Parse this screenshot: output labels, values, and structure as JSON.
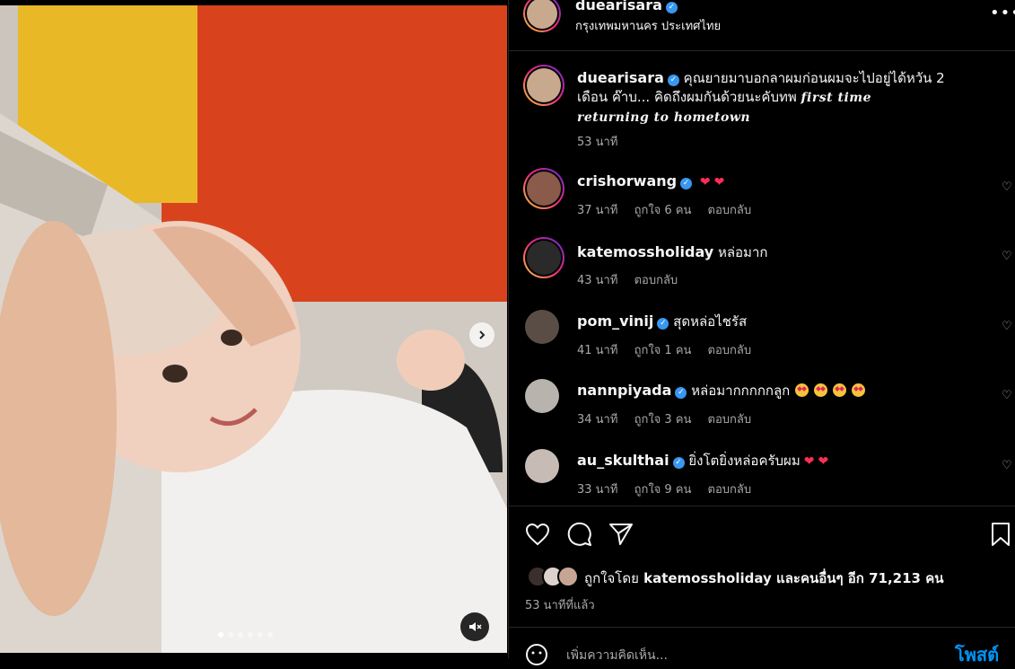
{
  "post": {
    "username": "duearisara",
    "location": "กรุงเทพมหานคร ประเทศไทย",
    "caption_text": "คุณยายมาบอกลาผมก่อนผมจะไปอยู่ได้หวัน 2 เดือน ค๊าบ... คิดถึงผมกันด้วยนะคับทพ",
    "caption_styled": "first time returning to hometown",
    "caption_time": "53 นาที"
  },
  "comments": [
    {
      "username": "crishorwang",
      "verified": true,
      "text": "",
      "reaction": "hearts",
      "time": "37 นาที",
      "likes": "ถูกใจ 6 คน",
      "reply": "ตอบกลับ"
    },
    {
      "username": "katemossholiday",
      "verified": false,
      "text": "หล่อมาก",
      "time": "43 นาที",
      "likes": "",
      "reply": "ตอบกลับ"
    },
    {
      "username": "pom_vinij",
      "verified": true,
      "text": "สุดหล่อไชรัส",
      "time": "41 นาที",
      "likes": "ถูกใจ 1 คน",
      "reply": "ตอบกลับ"
    },
    {
      "username": "nannpiyada",
      "verified": true,
      "text": "หล่อมากกกกกลูก",
      "reaction": "star-eyes",
      "time": "34 นาที",
      "likes": "ถูกใจ 3 คน",
      "reply": "ตอบกลับ"
    },
    {
      "username": "au_skulthai",
      "verified": true,
      "text": "ยิ่งโตยิ่งหล่อครับผม",
      "reaction": "hearts",
      "time": "33 นาที",
      "likes": "ถูกใจ 9 คน",
      "reply": "ตอบกลับ"
    }
  ],
  "liked_by": {
    "prefix": "ถูกใจโดย",
    "user": "katemossholiday",
    "and_others": "และคนอื่นๆ อีก 71,213 คน"
  },
  "posted_ago": "53 นาทีที่แล้ว",
  "comment_box": {
    "placeholder": "เพิ่มความคิดเห็น...",
    "post_label": "โพสต์"
  },
  "carousel": {
    "slide_count": 6,
    "active_index": 0
  },
  "icons": {
    "next": "chevron-right-icon",
    "mute": "speaker-muted-icon",
    "more": "more-horizontal-icon",
    "like": "heart-outline-icon",
    "comment": "speech-bubble-icon",
    "share": "paper-plane-icon",
    "save": "bookmark-icon",
    "emoji": "smiley-icon"
  },
  "colors": {
    "accent": "#0095f6",
    "verified": "#3897f0",
    "heart": "#ff2d55"
  }
}
